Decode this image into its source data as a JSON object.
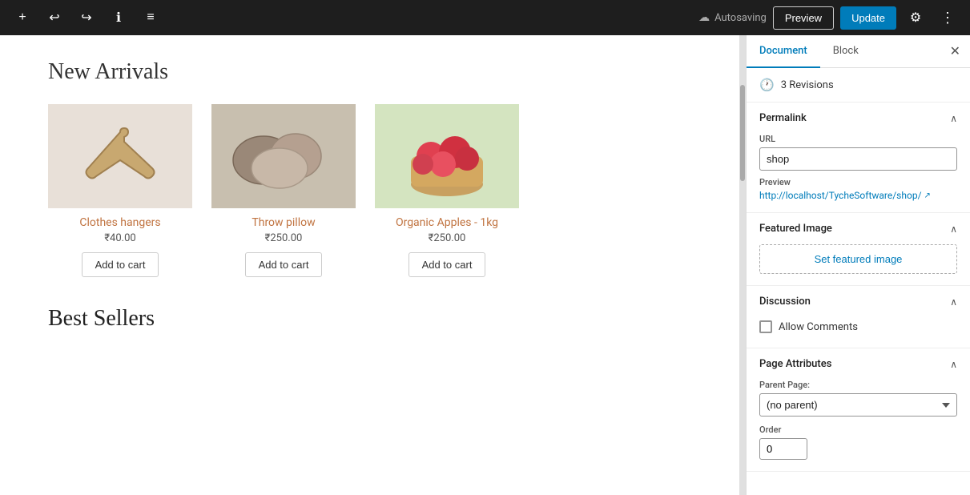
{
  "toolbar": {
    "add_icon": "+",
    "undo_icon": "↩",
    "redo_icon": "↪",
    "info_icon": "ℹ",
    "list_icon": "≡",
    "autosaving_label": "Autosaving",
    "preview_label": "Preview",
    "update_label": "Update",
    "gear_icon": "⚙",
    "dots_icon": "⋮"
  },
  "editor": {
    "section1_title": "New Arrivals",
    "section2_title": "Best Sellers",
    "products": [
      {
        "name": "Clothes hangers",
        "price": "₹40.00",
        "add_to_cart": "Add to cart",
        "img_type": "hanger",
        "img_icon": "🪝"
      },
      {
        "name": "Throw pillow",
        "price": "₹250.00",
        "add_to_cart": "Add to cart",
        "img_type": "pillow",
        "img_icon": "🛏"
      },
      {
        "name": "Organic Apples - 1kg",
        "price": "₹250.00",
        "add_to_cart": "Add to cart",
        "img_type": "apples",
        "img_icon": "🍎"
      }
    ]
  },
  "panel": {
    "tab_document": "Document",
    "tab_block": "Block",
    "close_icon": "✕",
    "revisions_icon": "🕐",
    "revisions_label": "3 Revisions",
    "permalink_section": {
      "label": "Permalink",
      "url_label": "URL",
      "url_value": "shop",
      "preview_label": "Preview",
      "preview_link": "http://localhost/TycheSoftware/shop/",
      "ext_icon": "↗"
    },
    "featured_image_section": {
      "label": "Featured Image",
      "set_button": "Set featured image"
    },
    "discussion_section": {
      "label": "Discussion",
      "allow_comments_label": "Allow Comments",
      "allow_comments_checked": false
    },
    "page_attributes_section": {
      "label": "Page Attributes",
      "parent_page_label": "Parent Page:",
      "parent_page_value": "(no parent)",
      "parent_page_options": [
        "(no parent)"
      ],
      "order_label": "Order",
      "order_value": "0"
    }
  }
}
